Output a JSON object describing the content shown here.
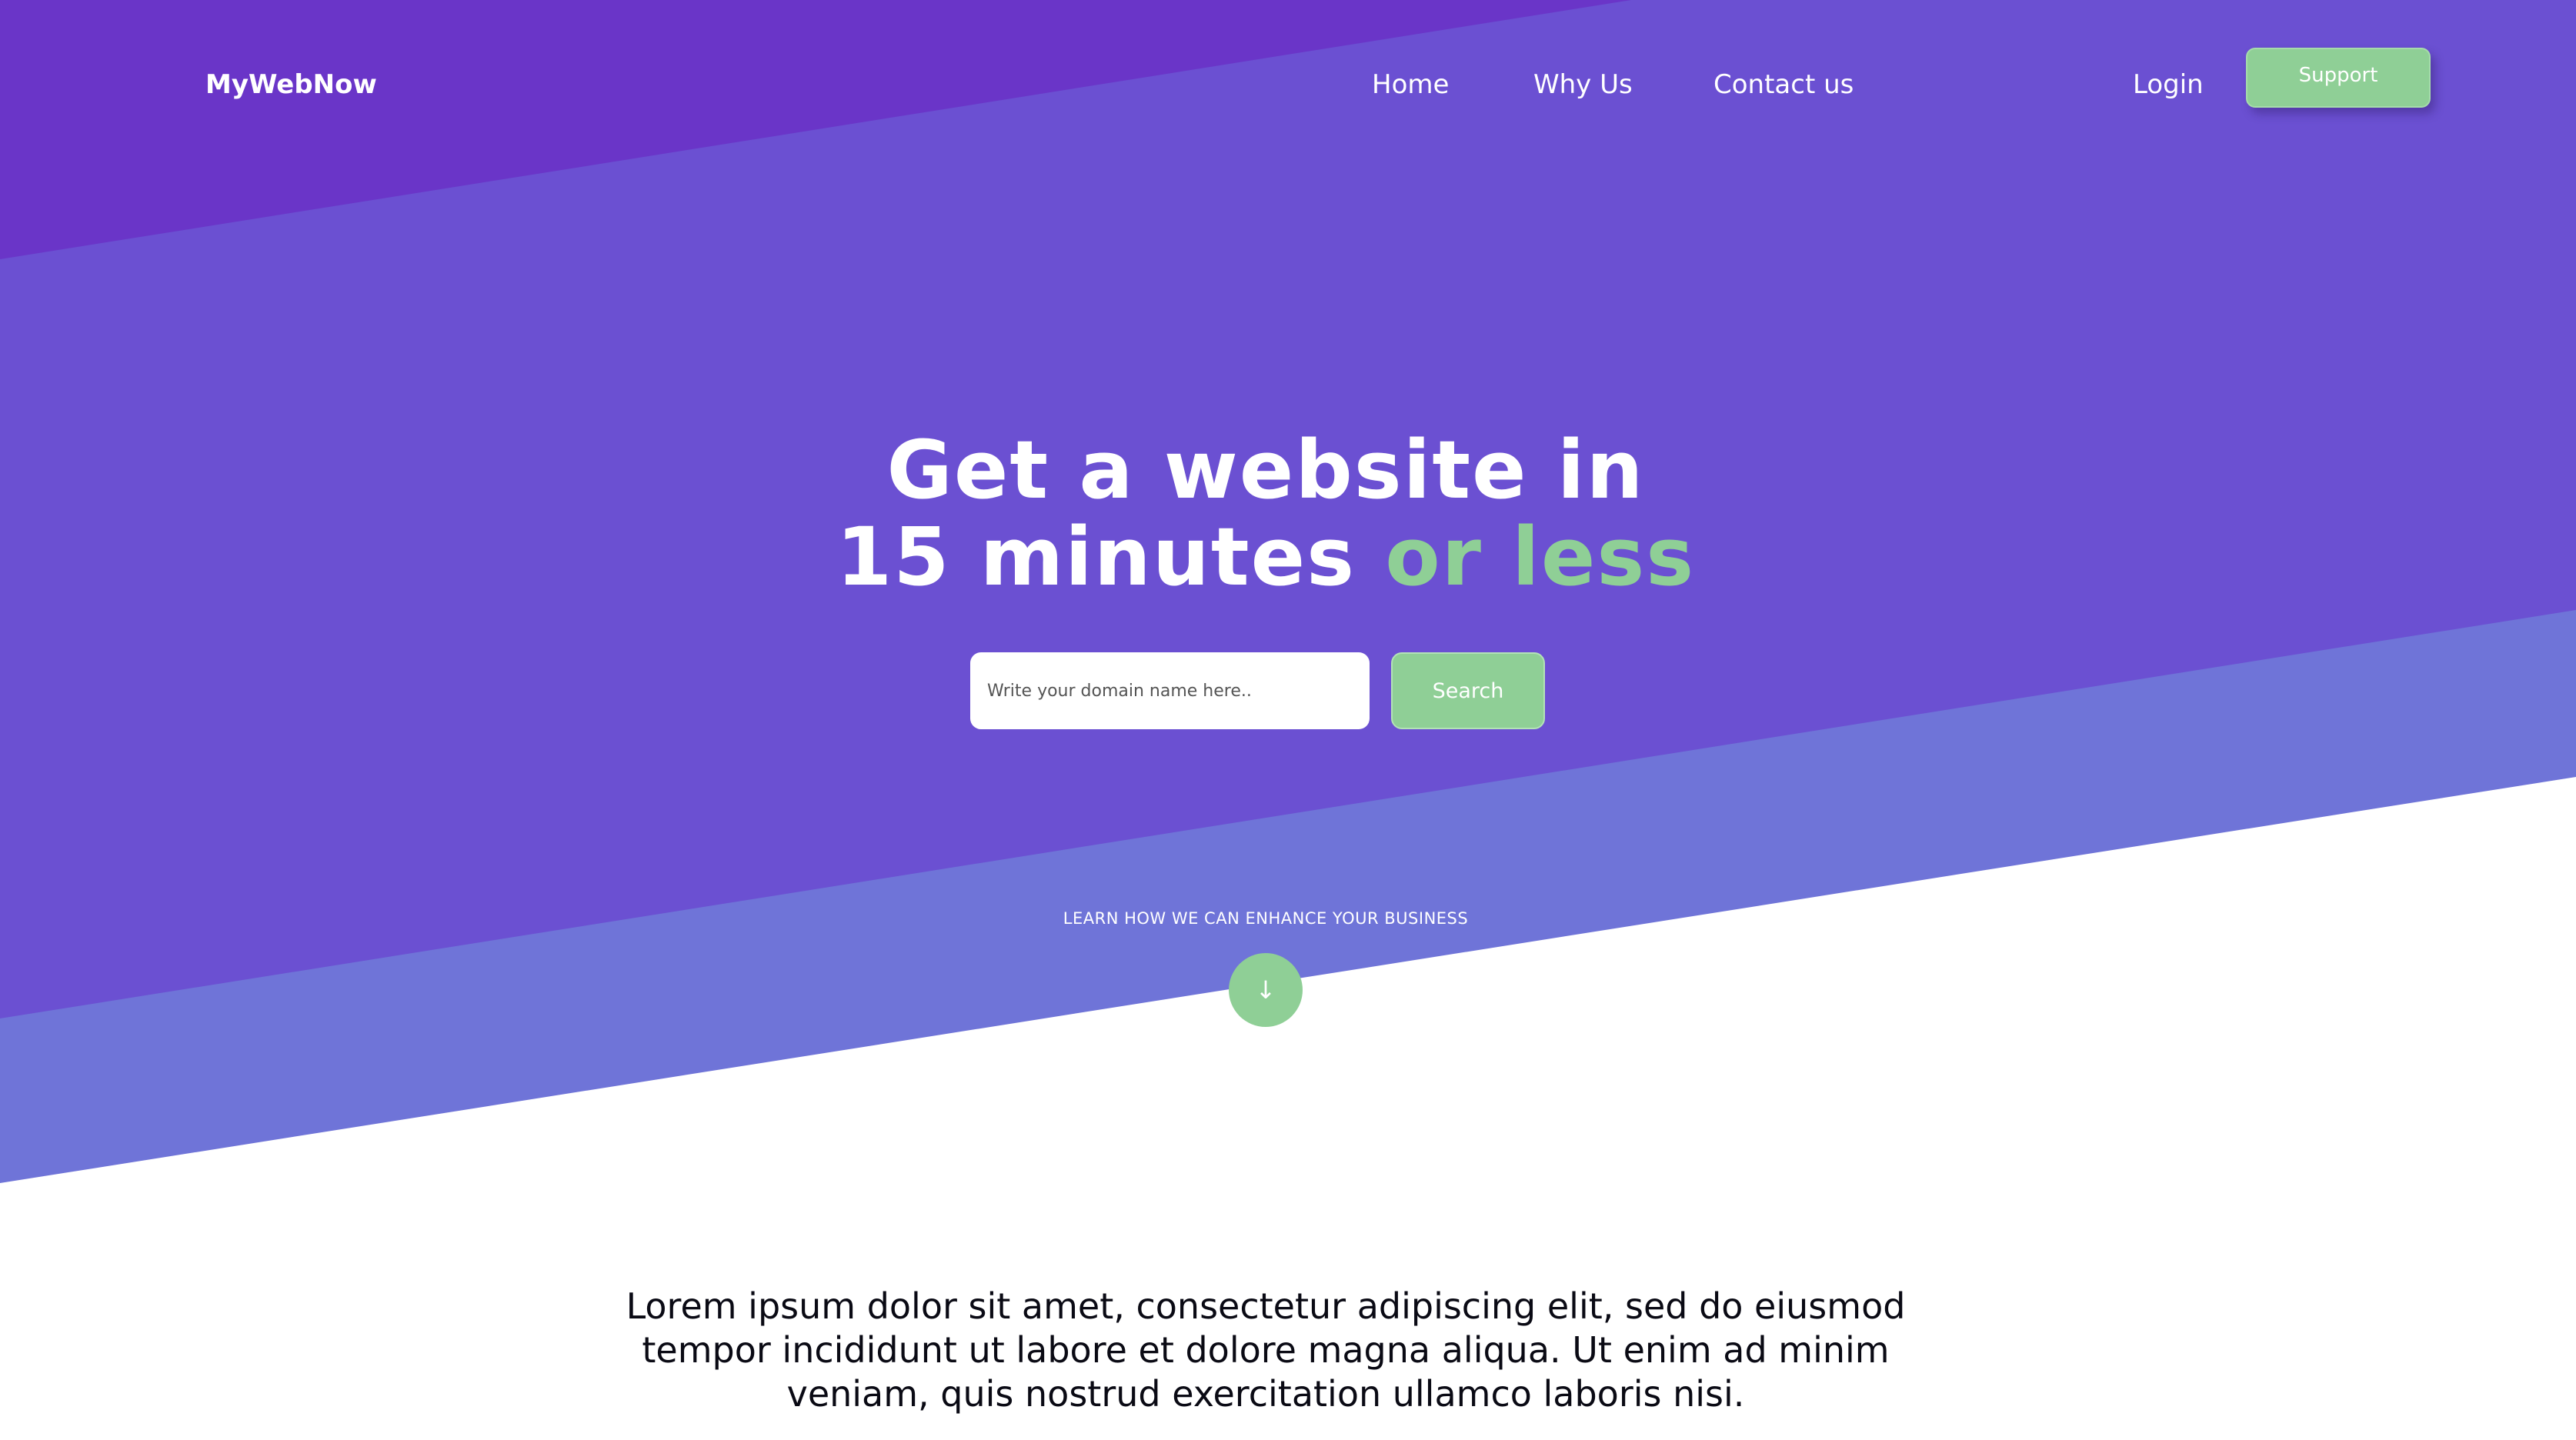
{
  "nav": {
    "brand": "MyWebNow",
    "links": [
      {
        "label": "Home"
      },
      {
        "label": "Why Us"
      },
      {
        "label": "Contact us"
      }
    ],
    "login_label": "Login",
    "support_label": "Support"
  },
  "hero": {
    "title_line1": "Get a website in",
    "title_line2_main": "15 minutes ",
    "title_line2_accent": "or less",
    "search_placeholder": "Write your domain name here..",
    "search_button": "Search",
    "learn_text": "LEARN HOW WE CAN ENHANCE YOUR BUSINESS",
    "down_icon": "down-arrow-icon"
  },
  "content": {
    "paragraph": "Lorem ipsum dolor sit amet, consectetur adipiscing elit, sed do eiusmod tempor incididunt ut labore et dolore magna aliqua. Ut enim ad minim veniam, quis nostrud exercitation ullamco laboris nisi."
  },
  "colors": {
    "dark_purple": "#6a35c8",
    "main_purple": "#6b50d2",
    "light_band": "#6f74d8",
    "accent_green": "#8fcf96",
    "text_white": "#ffffff",
    "body_text": "#0a0a14"
  }
}
